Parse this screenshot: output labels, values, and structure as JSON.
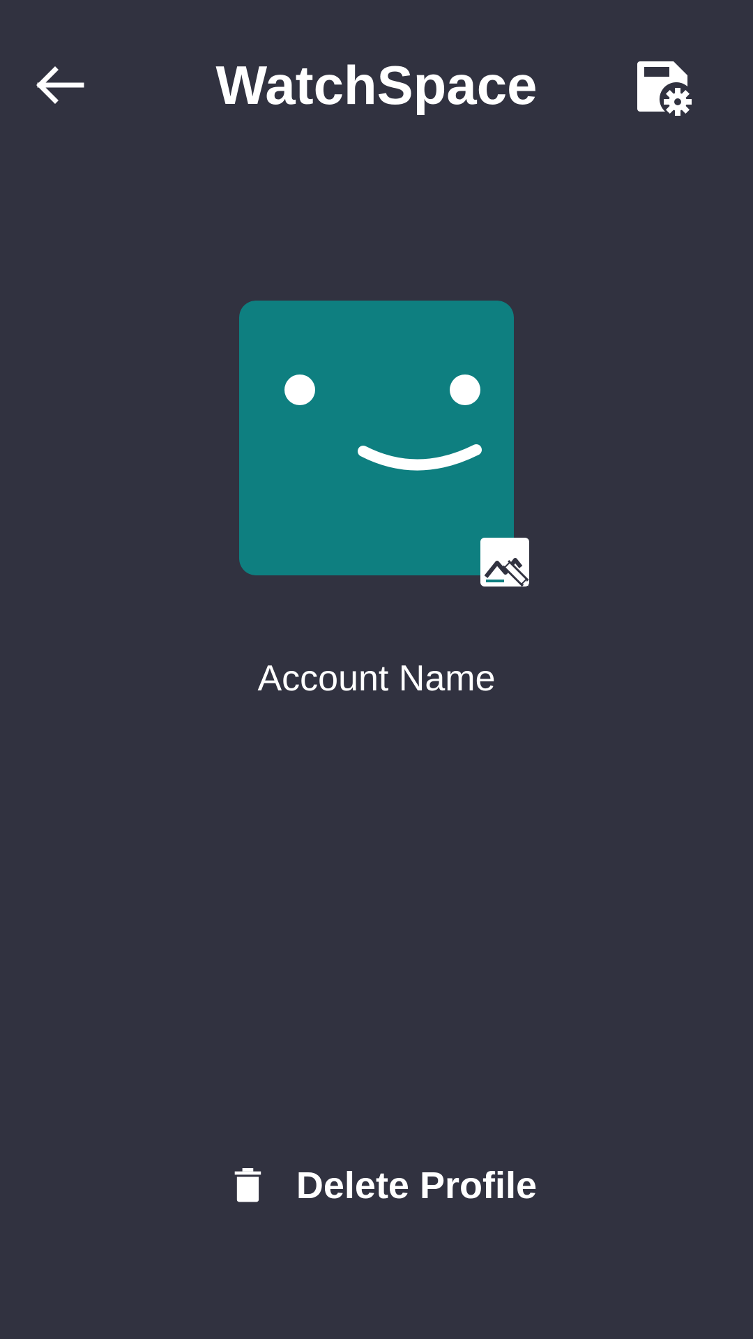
{
  "header": {
    "title": "WatchSpace",
    "back_icon": "arrow-left-icon",
    "save_icon": "save-settings-icon"
  },
  "profile": {
    "avatar_color": "#0e7f80",
    "avatar_icon": "smiley-face-avatar",
    "edit_icon": "edit-image-icon",
    "account_name": "Account Name"
  },
  "actions": {
    "delete_label": "Delete Profile",
    "delete_icon": "trash-icon"
  },
  "colors": {
    "background": "#313240",
    "foreground": "#ffffff",
    "accent": "#0e7f80"
  }
}
